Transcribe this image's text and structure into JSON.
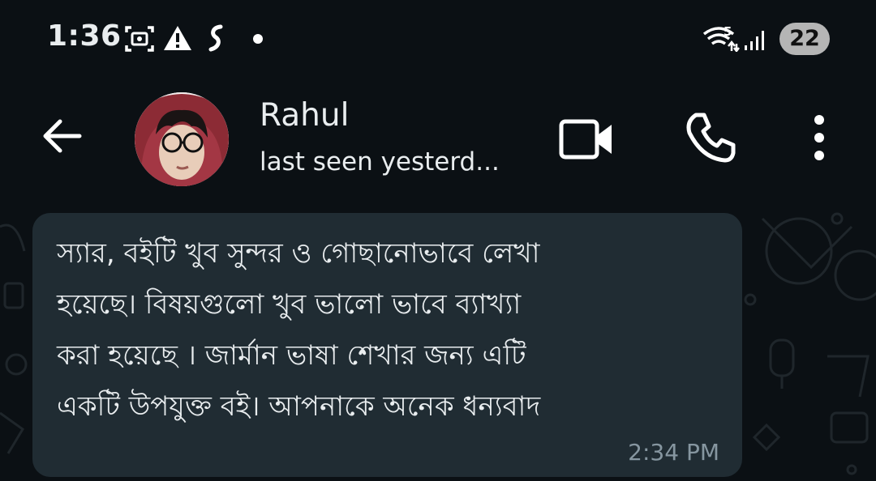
{
  "status_bar": {
    "time": "1:36",
    "icons": [
      "screen-record-icon",
      "warning-icon",
      "swipe-app-icon",
      "dot-icon"
    ],
    "right_icons": [
      "wifi-icon",
      "signal-icon"
    ],
    "wifi_badge": "5",
    "battery": "22"
  },
  "header": {
    "contact_name": "Rahul",
    "last_seen": "last seen yesterd...",
    "icons": [
      "back-arrow-icon",
      "video-call-icon",
      "phone-icon",
      "more-vert-icon"
    ]
  },
  "message": {
    "lines": [
      "স্যার, বইটি খুব সুন্দর ও গোছানোভাবে লেখা",
      "হয়েছে। বিষয়গুলো খুব ভালো ভাবে ব্যাখ্যা",
      "করা হয়েছে । জার্মান ভাষা শেখার জন্য এটি",
      "একটি উপযুক্ত বই। আপনাকে অনেক ধন্যবাদ"
    ],
    "time": "2:34 PM"
  },
  "colors": {
    "background": "#0b1014",
    "bubble": "#202c33",
    "timestamp": "#8696a0",
    "text": "#e9edef"
  }
}
